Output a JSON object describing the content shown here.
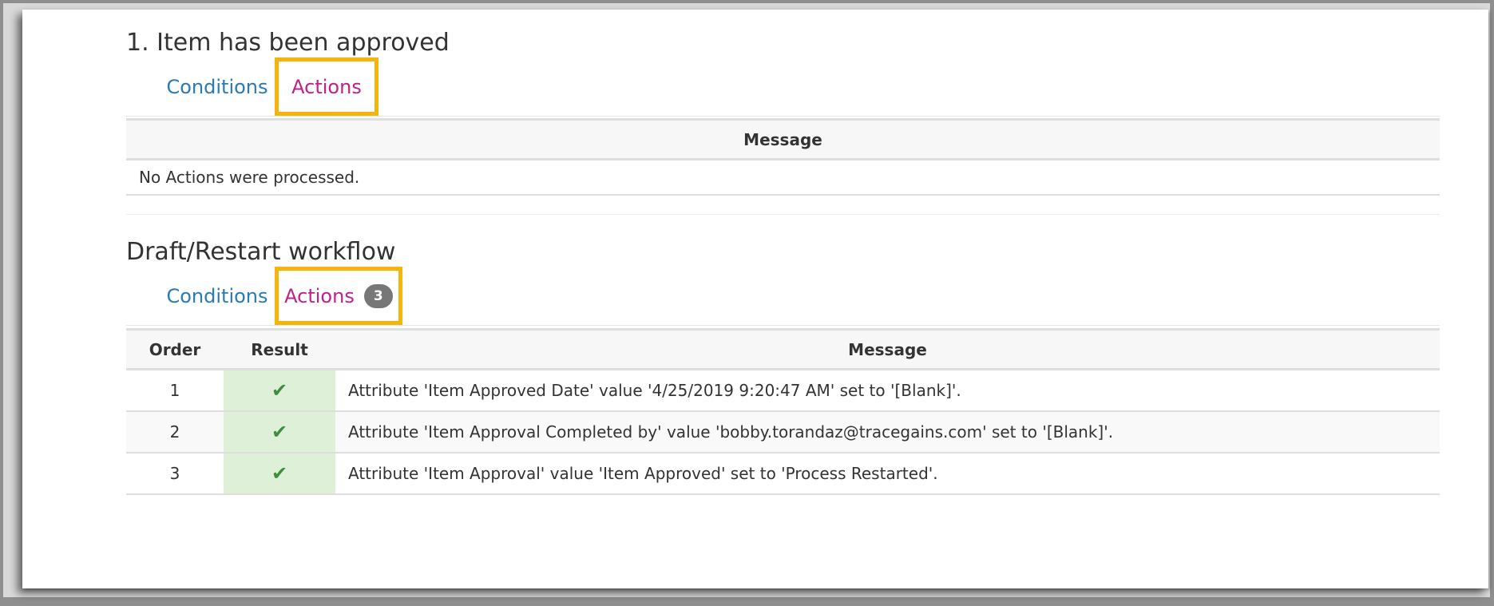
{
  "sections": [
    {
      "title": "1. Item has been approved",
      "tabs": {
        "conditions": "Conditions",
        "actions": "Actions"
      },
      "table": {
        "header_message": "Message",
        "empty_message": "No Actions were processed."
      }
    },
    {
      "title": "Draft/Restart workflow",
      "tabs": {
        "conditions": "Conditions",
        "actions": "Actions",
        "actions_badge": "3"
      },
      "table": {
        "headers": {
          "order": "Order",
          "result": "Result",
          "message": "Message"
        },
        "rows": [
          {
            "order": "1",
            "result_icon": "checkmark-icon",
            "message": "Attribute 'Item Approved Date' value '4/25/2019 9:20:47 AM' set to '[Blank]'."
          },
          {
            "order": "2",
            "result_icon": "checkmark-icon",
            "message": "Attribute 'Item Approval Completed by' value 'bobby.torandaz@tracegains.com' set to '[Blank]'."
          },
          {
            "order": "3",
            "result_icon": "checkmark-icon",
            "message": "Attribute 'Item Approval' value 'Item Approved' set to 'Process Restarted'."
          }
        ]
      }
    }
  ],
  "colors": {
    "highlight": "#f5b40b",
    "active_tab": "#c0208b",
    "inactive_tab": "#2a7ab3",
    "success_cell": "#dff0d8",
    "check": "#3c8d3c"
  }
}
